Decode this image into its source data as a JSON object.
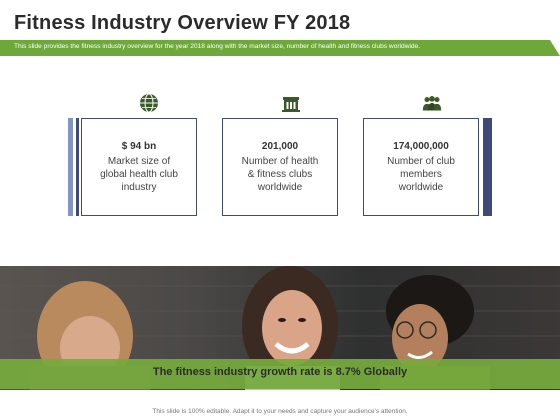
{
  "slide": {
    "title": "Fitness Industry Overview FY 2018",
    "subtitle": "This slide provides the fitness industry overview for the year 2018 along with the market size, number of health and fitness clubs worldwide.",
    "accent_green": "#6fa83a",
    "accent_navy": "#3d4a7a"
  },
  "cards": [
    {
      "icon": "globe-icon",
      "value": "$ 94 bn",
      "description": "Market size of global health club industry"
    },
    {
      "icon": "building-icon",
      "value": "201,000",
      "description": "Number of health & fitness clubs worldwide"
    },
    {
      "icon": "people-icon",
      "value": "174,000,000",
      "description": "Number of club members worldwide"
    }
  ],
  "growth_banner": "The fitness industry growth rate is 8.7% Globally",
  "footer": "This slide is 100% editable. Adapt it to your needs and capture your audience's attention."
}
